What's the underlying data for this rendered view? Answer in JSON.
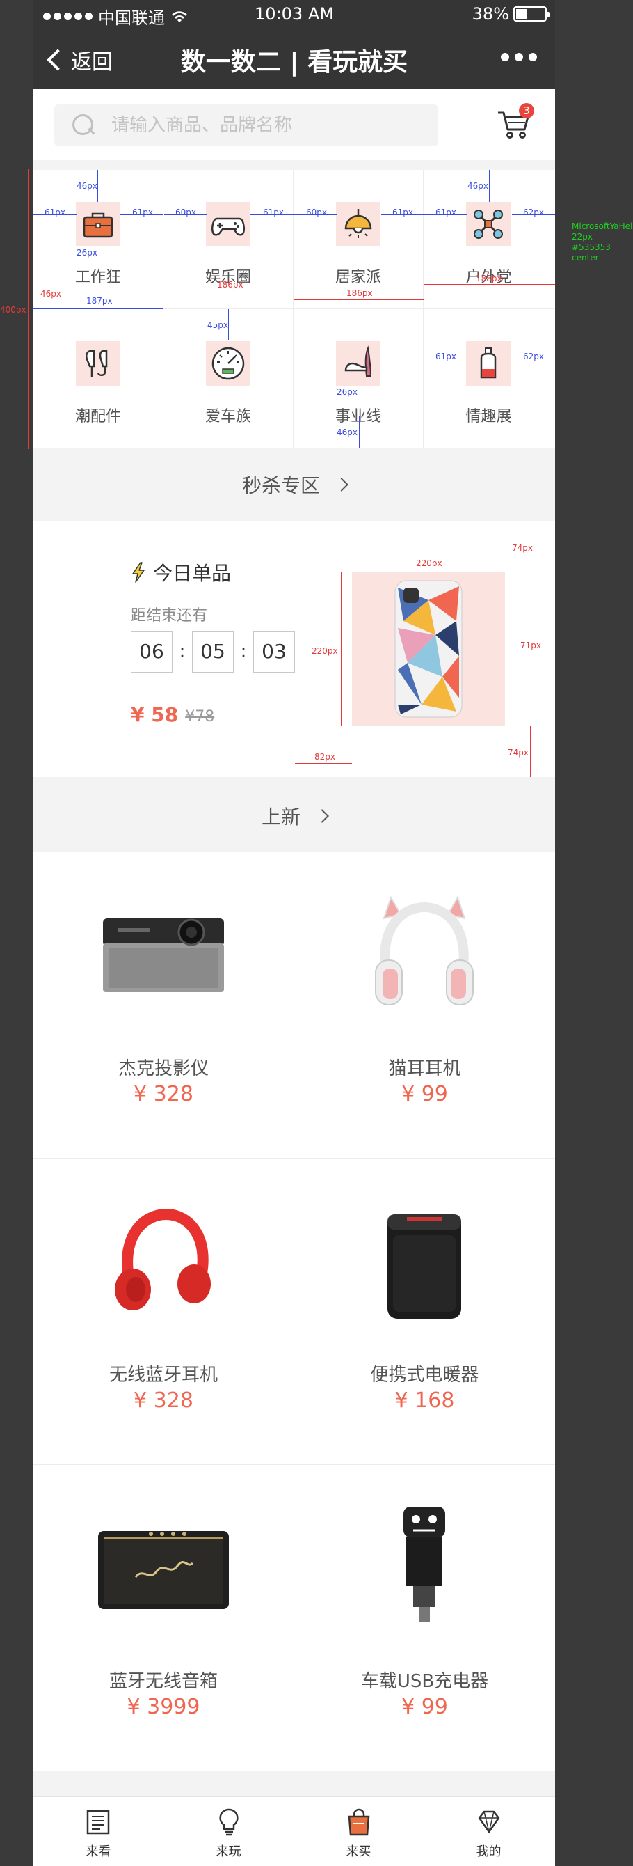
{
  "status_bar": {
    "carrier": "中国联通",
    "time": "10:03 AM",
    "battery": "38%",
    "battery_level": 0.38
  },
  "nav": {
    "back_label": "返回",
    "title": "数一数二 | 看玩就买"
  },
  "search": {
    "placeholder": "请输入商品、品牌名称",
    "cart_count": "3"
  },
  "categories": [
    {
      "label": "工作狂",
      "icon": "briefcase-icon"
    },
    {
      "label": "娱乐圈",
      "icon": "gamepad-icon"
    },
    {
      "label": "居家派",
      "icon": "ceiling-lamp-icon"
    },
    {
      "label": "户外党",
      "icon": "drone-icon"
    },
    {
      "label": "潮配件",
      "icon": "earphones-icon"
    },
    {
      "label": "爱车族",
      "icon": "speedometer-icon"
    },
    {
      "label": "事业线",
      "icon": "high-heel-icon"
    },
    {
      "label": "情趣展",
      "icon": "perfume-bottle-icon"
    }
  ],
  "flash_sale": {
    "header": "秒杀专区",
    "title": "今日单品",
    "countdown_label": "距结束还有",
    "hours": "06",
    "minutes": "05",
    "seconds": "03",
    "price": "¥ 58",
    "original_price": "¥78"
  },
  "new_arrivals": {
    "header": "上新",
    "products": [
      {
        "name": "杰克投影仪",
        "price": "¥ 328"
      },
      {
        "name": "猫耳耳机",
        "price": "¥ 99"
      },
      {
        "name": "无线蓝牙耳机",
        "price": "¥ 328"
      },
      {
        "name": "便携式电暖器",
        "price": "¥ 168"
      },
      {
        "name": "蓝牙无线音箱",
        "price": "¥ 3999"
      },
      {
        "name": "车载USB充电器",
        "price": "¥ 99"
      }
    ]
  },
  "tabbar": [
    {
      "label": "来看",
      "icon": "newspaper-icon"
    },
    {
      "label": "来玩",
      "icon": "lightbulb-icon"
    },
    {
      "label": "来买",
      "icon": "shopping-bag-icon"
    },
    {
      "label": "我的",
      "icon": "diamond-icon"
    }
  ],
  "annotations": {
    "m46": "46px",
    "m61": "61px",
    "m60": "60px",
    "m62": "62px",
    "m26": "26px",
    "m45": "45px",
    "m186": "186px",
    "m187": "187px",
    "m188": "188px",
    "m400": "400px",
    "m220": "220px",
    "m74": "74px",
    "m71": "71px",
    "m82": "82px",
    "font_name": "MicrosoftYaHei",
    "font_size": "22px",
    "font_color": "#535353",
    "font_align": "center"
  },
  "colors": {
    "accent": "#f06650",
    "badge": "#e8463c",
    "text": "#535353",
    "icon_bg": "#fbe3df",
    "nav_bg": "#353535"
  }
}
